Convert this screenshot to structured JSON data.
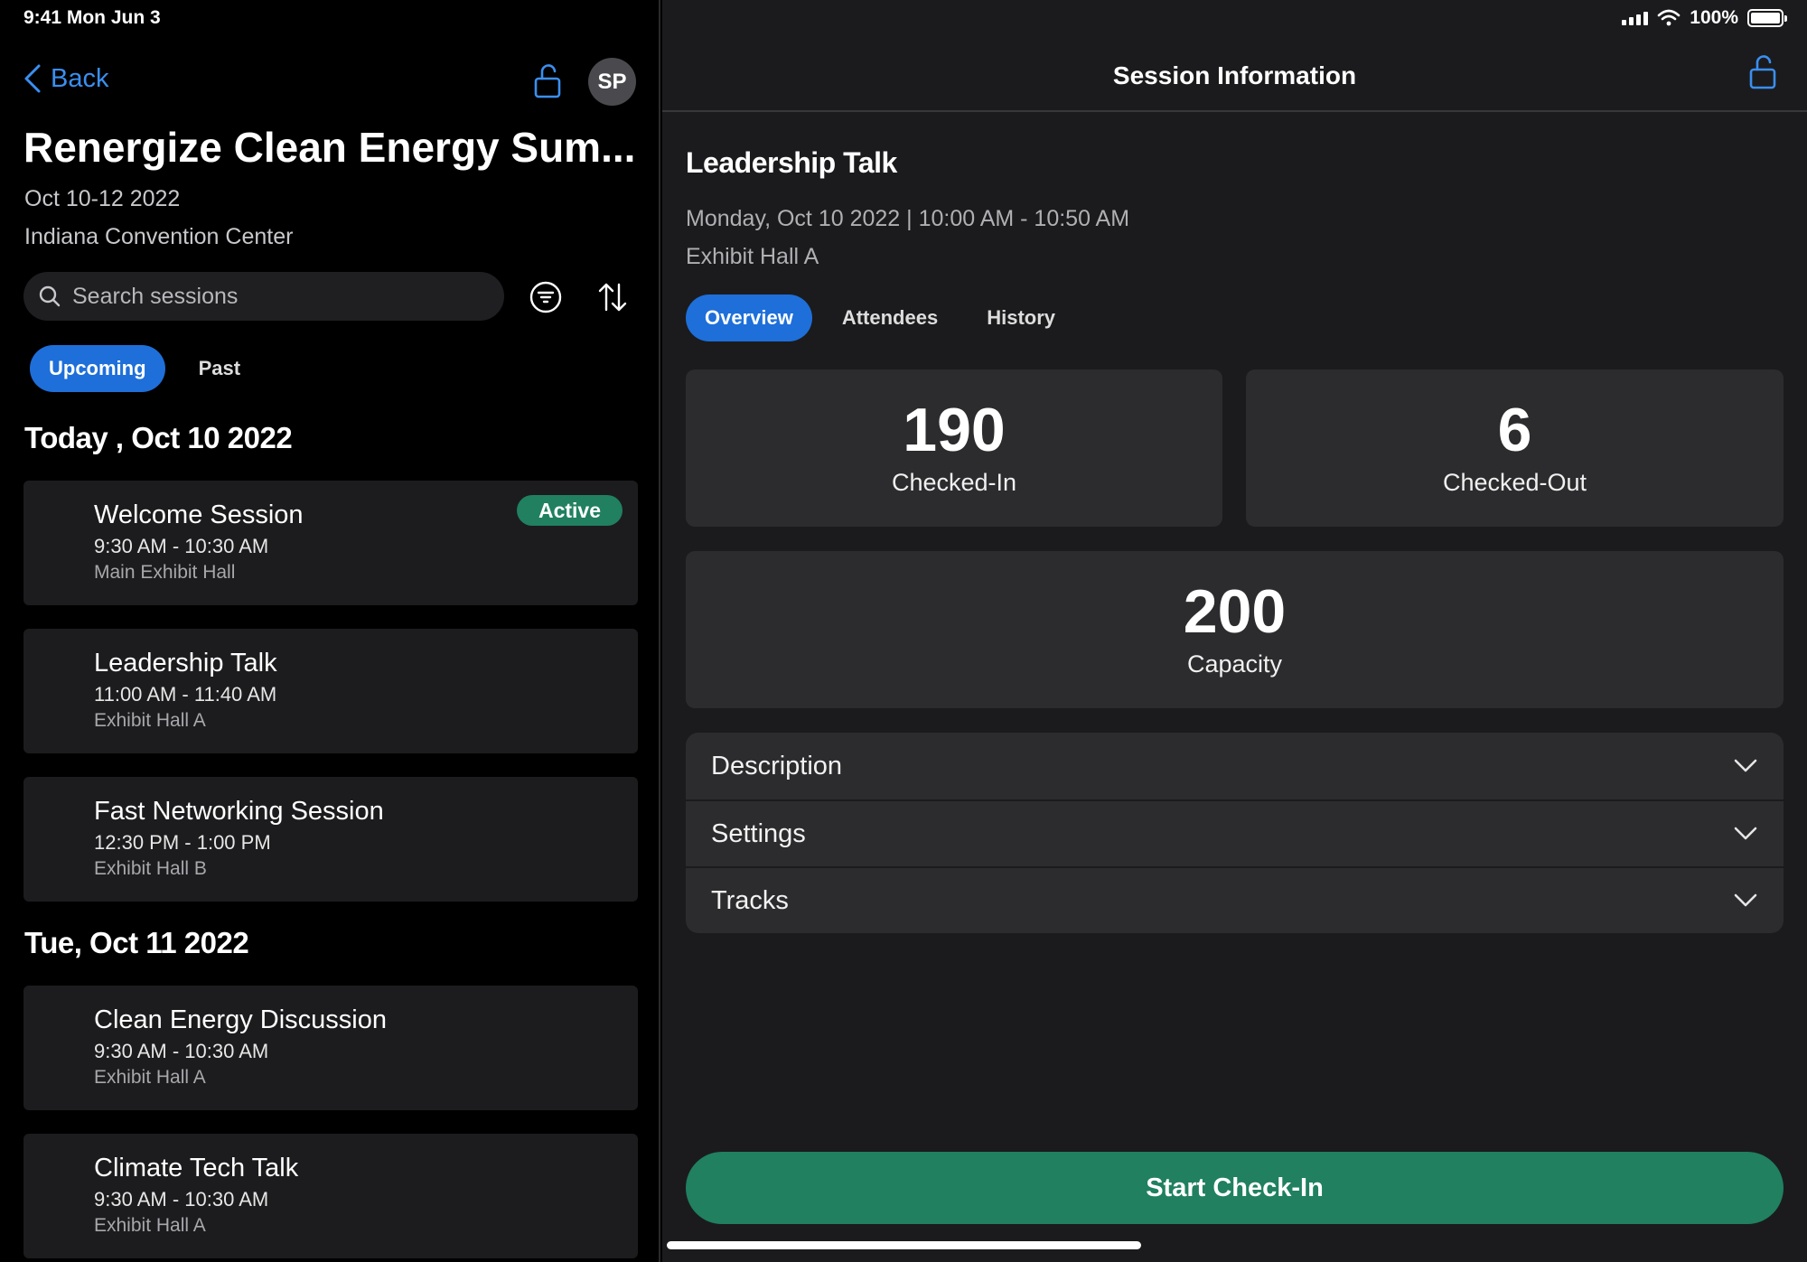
{
  "status": {
    "time": "9:41  Mon Jun 3",
    "battery": "100%"
  },
  "left": {
    "back_label": "Back",
    "avatar_initials": "SP",
    "event_title": "Renergize Clean Energy Sum...",
    "event_dates": "Oct 10-12 2022",
    "event_venue": "Indiana Convention Center",
    "search_placeholder": "Search sessions",
    "tabs": [
      "Upcoming",
      "Past"
    ],
    "days": [
      {
        "header": "Today , Oct 10 2022",
        "sessions": [
          {
            "title": "Welcome Session",
            "time": "9:30 AM - 10:30 AM",
            "location": "Main Exhibit Hall",
            "badge": "Active"
          },
          {
            "title": "Leadership Talk",
            "time": "11:00 AM - 11:40 AM",
            "location": "Exhibit Hall A"
          },
          {
            "title": "Fast Networking Session",
            "time": "12:30 PM - 1:00 PM",
            "location": "Exhibit Hall B"
          }
        ]
      },
      {
        "header": "Tue,  Oct 11 2022",
        "sessions": [
          {
            "title": "Clean Energy Discussion",
            "time": "9:30 AM - 10:30 AM",
            "location": "Exhibit Hall A"
          },
          {
            "title": "Climate Tech Talk",
            "time": "9:30 AM - 10:30 AM",
            "location": "Exhibit Hall A"
          }
        ]
      }
    ]
  },
  "right": {
    "nav_title": "Session Information",
    "session_title": "Leadership Talk",
    "session_time": "Monday, Oct 10 2022 | 10:00 AM - 10:50 AM",
    "session_location": "Exhibit Hall A",
    "tabs": [
      "Overview",
      "Attendees",
      "History"
    ],
    "stats": {
      "checked_in": {
        "value": "190",
        "label": "Checked-In"
      },
      "checked_out": {
        "value": "6",
        "label": "Checked-Out"
      },
      "capacity": {
        "value": "200",
        "label": "Capacity"
      }
    },
    "sections": [
      "Description",
      "Settings",
      "Tracks"
    ],
    "cta_label": "Start Check-In"
  },
  "colors": {
    "accent": "#1e6fd9",
    "link": "#3a8ff0",
    "success": "#208060"
  }
}
